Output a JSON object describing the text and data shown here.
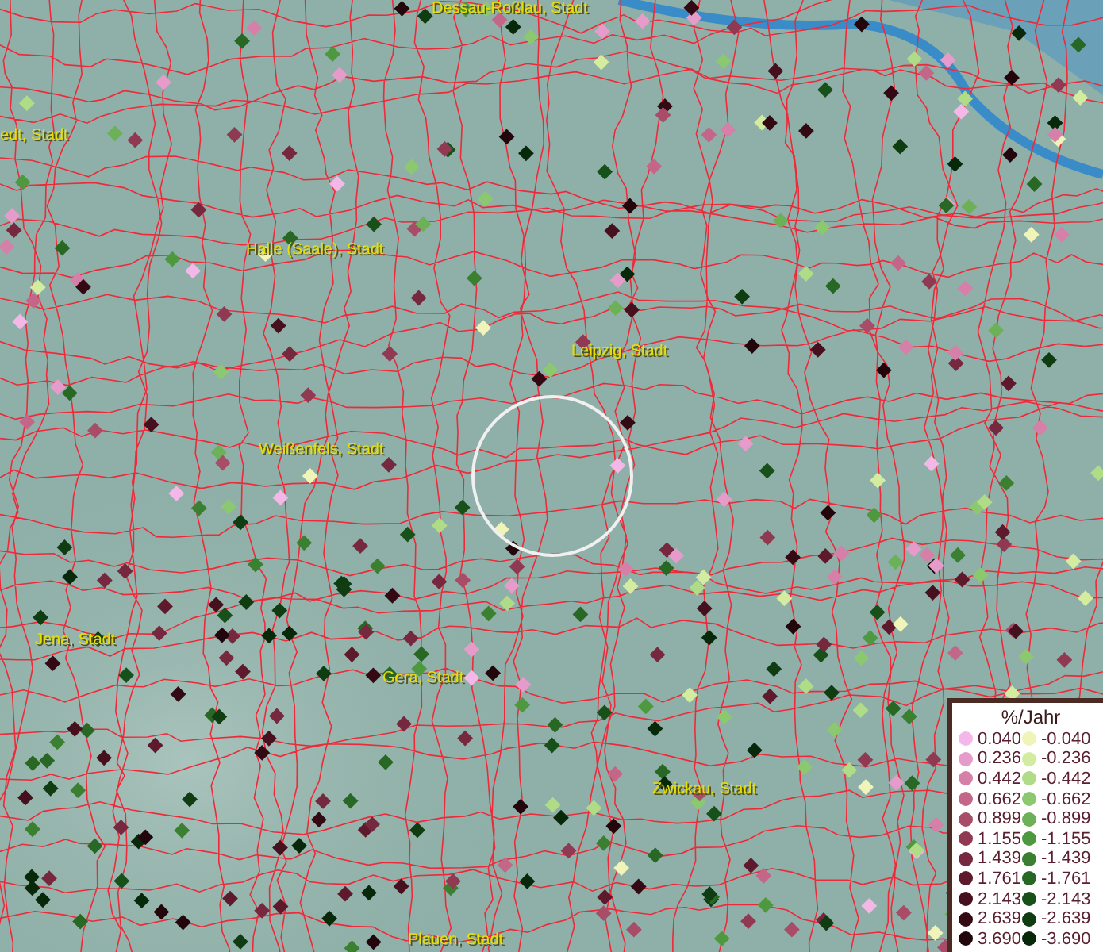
{
  "map": {
    "place_labels": [
      "Dessau-Roßlau, Stadt",
      "edt, Stadt",
      "Halle (Saale), Stadt",
      "Leipzig, Stadt",
      "Weißenfels, Stadt",
      "Jena, Stadt",
      "Gera, Stadt",
      "Zwickau, Stadt",
      "Plauen, Stadt"
    ]
  },
  "legend": {
    "title": "%/Jahr",
    "rows": [
      {
        "left": {
          "label": "0.040",
          "color": "#f4b8e8"
        },
        "right": {
          "label": "-0.040",
          "color": "#f0f4b8"
        }
      },
      {
        "left": {
          "label": "0.236",
          "color": "#e59ccb"
        },
        "right": {
          "label": "-0.236",
          "color": "#d4eca0"
        }
      },
      {
        "left": {
          "label": "0.442",
          "color": "#d67fa8"
        },
        "right": {
          "label": "-0.442",
          "color": "#b0dc88"
        }
      },
      {
        "left": {
          "label": "0.662",
          "color": "#c46688"
        },
        "right": {
          "label": "-0.662",
          "color": "#8cc870"
        }
      },
      {
        "left": {
          "label": "0.899",
          "color": "#a84c68"
        },
        "right": {
          "label": "-0.899",
          "color": "#6cb058"
        }
      },
      {
        "left": {
          "label": "1.155",
          "color": "#8f3a52"
        },
        "right": {
          "label": "-1.155",
          "color": "#4e9840"
        }
      },
      {
        "left": {
          "label": "1.439",
          "color": "#76283e"
        },
        "right": {
          "label": "-1.439",
          "color": "#3a8030"
        }
      },
      {
        "left": {
          "label": "1.761",
          "color": "#5e1a2c"
        },
        "right": {
          "label": "-1.761",
          "color": "#286824"
        }
      },
      {
        "left": {
          "label": "2.143",
          "color": "#47101e"
        },
        "right": {
          "label": "-2.143",
          "color": "#18501a"
        }
      },
      {
        "left": {
          "label": "2.639",
          "color": "#330a14"
        },
        "right": {
          "label": "-2.639",
          "color": "#103c12"
        }
      },
      {
        "left": {
          "label": "3.690",
          "color": "#22060c"
        },
        "right": {
          "label": "-3.690",
          "color": "#08280a"
        }
      }
    ]
  }
}
